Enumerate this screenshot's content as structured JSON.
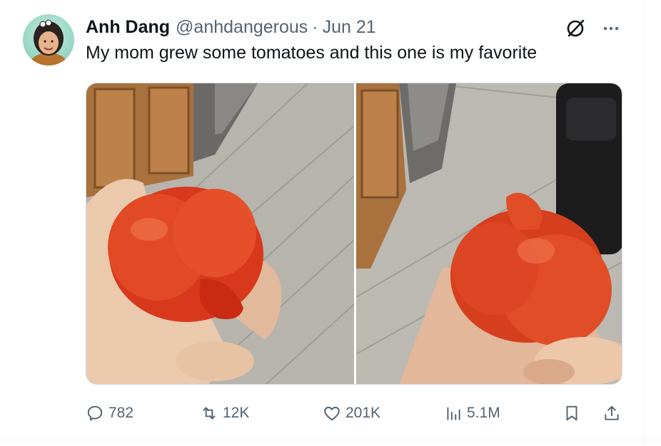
{
  "tweet": {
    "author_name": "Anh Dang",
    "handle": "@anhdangerous",
    "separator": "·",
    "date": "Jun 21",
    "text": "My mom grew some tomatoes and this one is my favorite"
  },
  "icons": {
    "avatar": "avatar-image",
    "grok": "grok-icon",
    "more": "more-icon",
    "reply": "reply-icon",
    "retweet": "retweet-icon",
    "like": "like-icon",
    "views": "views-icon",
    "bookmark": "bookmark-icon",
    "share": "share-icon"
  },
  "actions": {
    "reply_count": "782",
    "retweet_count": "12K",
    "like_count": "201K",
    "view_count": "5.1M"
  },
  "colors": {
    "text_primary": "#0f1419",
    "text_secondary": "#536471",
    "border": "#cfd9de"
  }
}
